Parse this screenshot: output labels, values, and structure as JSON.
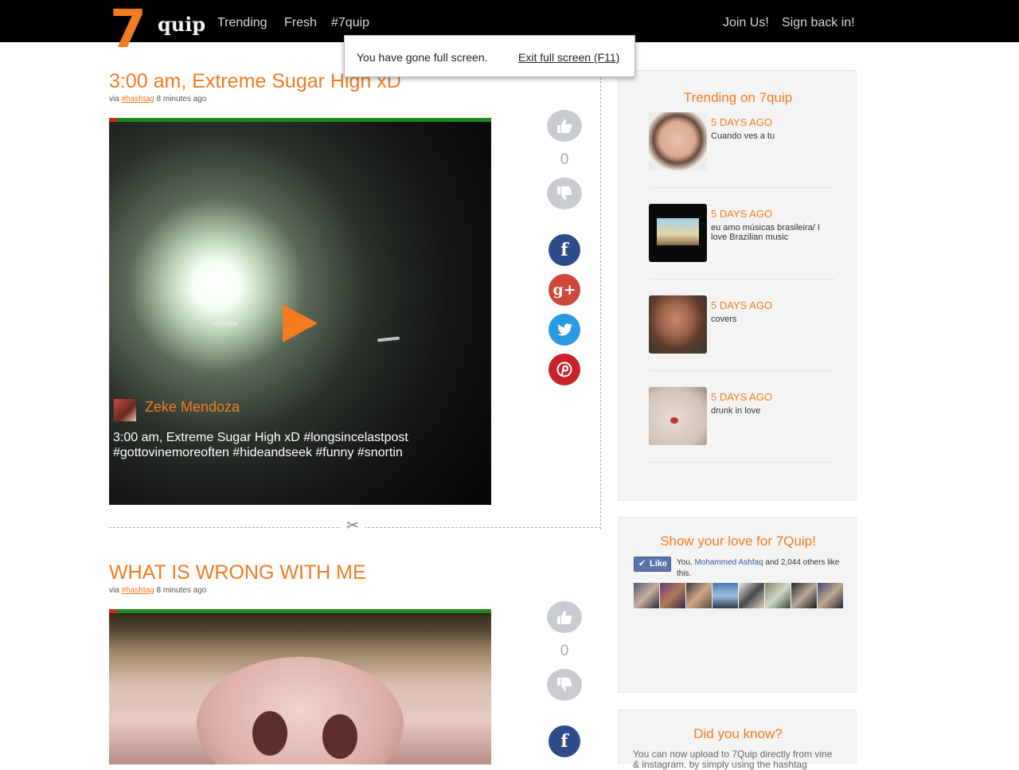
{
  "header": {
    "logo_number": "7",
    "logo_word": "quip",
    "nav": [
      "Trending",
      "Fresh",
      "#7quip"
    ],
    "join": "Join Us!",
    "signin": "Sign back in!"
  },
  "fullscreen_notice": {
    "message": "You have gone full screen.",
    "exit_label": "Exit full screen (F11)"
  },
  "posts": [
    {
      "title": "3:00 am, Extreme Sugar High xD",
      "via": "via",
      "tag": "#hashtag",
      "time": "8 minutes ago",
      "author": "Zeke Mendoza",
      "caption": "3:00 am, Extreme Sugar High xD #longsincelastpost #gottovinemoreoften #hideandseek #funny #snortin",
      "votes": "0"
    },
    {
      "title": "WHAT IS WRONG WITH ME",
      "via": "via",
      "tag": "#hashtag",
      "time": "8 minutes ago",
      "votes": "0"
    }
  ],
  "share_icons": [
    "facebook-icon",
    "google-plus-icon",
    "twitter-icon",
    "pinterest-icon"
  ],
  "share_glyphs": {
    "facebook": "f",
    "google": "g+"
  },
  "scissors_glyph": "✂",
  "like_button": "Like",
  "like_check": "✔",
  "trending": {
    "title": "Trending on 7quip",
    "items": [
      {
        "ago": "5 DAYS AGO",
        "desc": "Cuando ves a tu"
      },
      {
        "ago": "5 DAYS AGO",
        "desc": "eu amo músicas brasileira/ I love Brazilian music"
      },
      {
        "ago": "5 DAYS AGO",
        "desc": "covers"
      },
      {
        "ago": "5 DAYS AGO",
        "desc": "drunk in love"
      }
    ]
  },
  "love": {
    "title": "Show your love for 7Quip!",
    "like_prefix": "You,",
    "like_name": "Mohammed Ashfaq",
    "like_suffix": "and 2,044 others like this."
  },
  "didyouknow": {
    "title": "Did you know?",
    "text": "You can now upload to 7Quip directly from vine & instagram, by simply using the hashtag"
  },
  "colors": {
    "accent": "#f47b20",
    "facebook": "#2e4b8a",
    "google": "#d0463b",
    "twitter": "#2a9ae6",
    "pinterest": "#c9222a"
  }
}
